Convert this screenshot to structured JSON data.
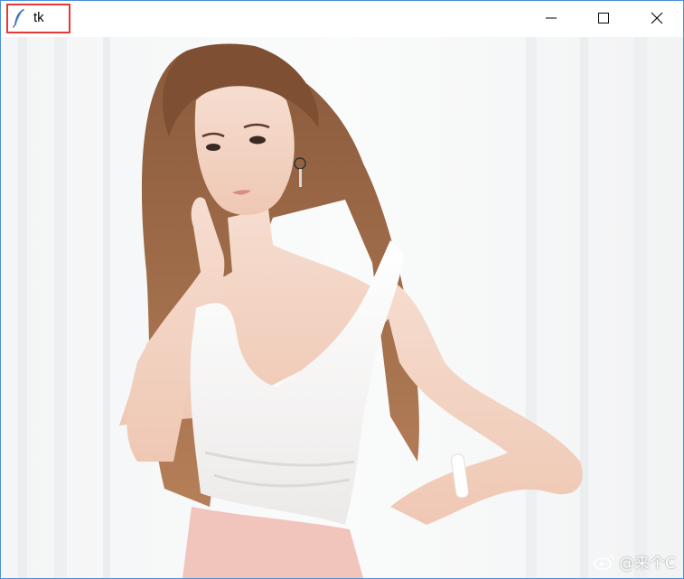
{
  "window": {
    "title": "tk",
    "controls": {
      "minimize_icon": "minimize-icon",
      "maximize_icon": "maximize-icon",
      "close_icon": "close-icon"
    },
    "border_color": "#4a90d9",
    "highlight_color": "#e53935"
  },
  "content": {
    "image_watermark": "@来个C",
    "watermark_icon": "weibo-icon"
  }
}
